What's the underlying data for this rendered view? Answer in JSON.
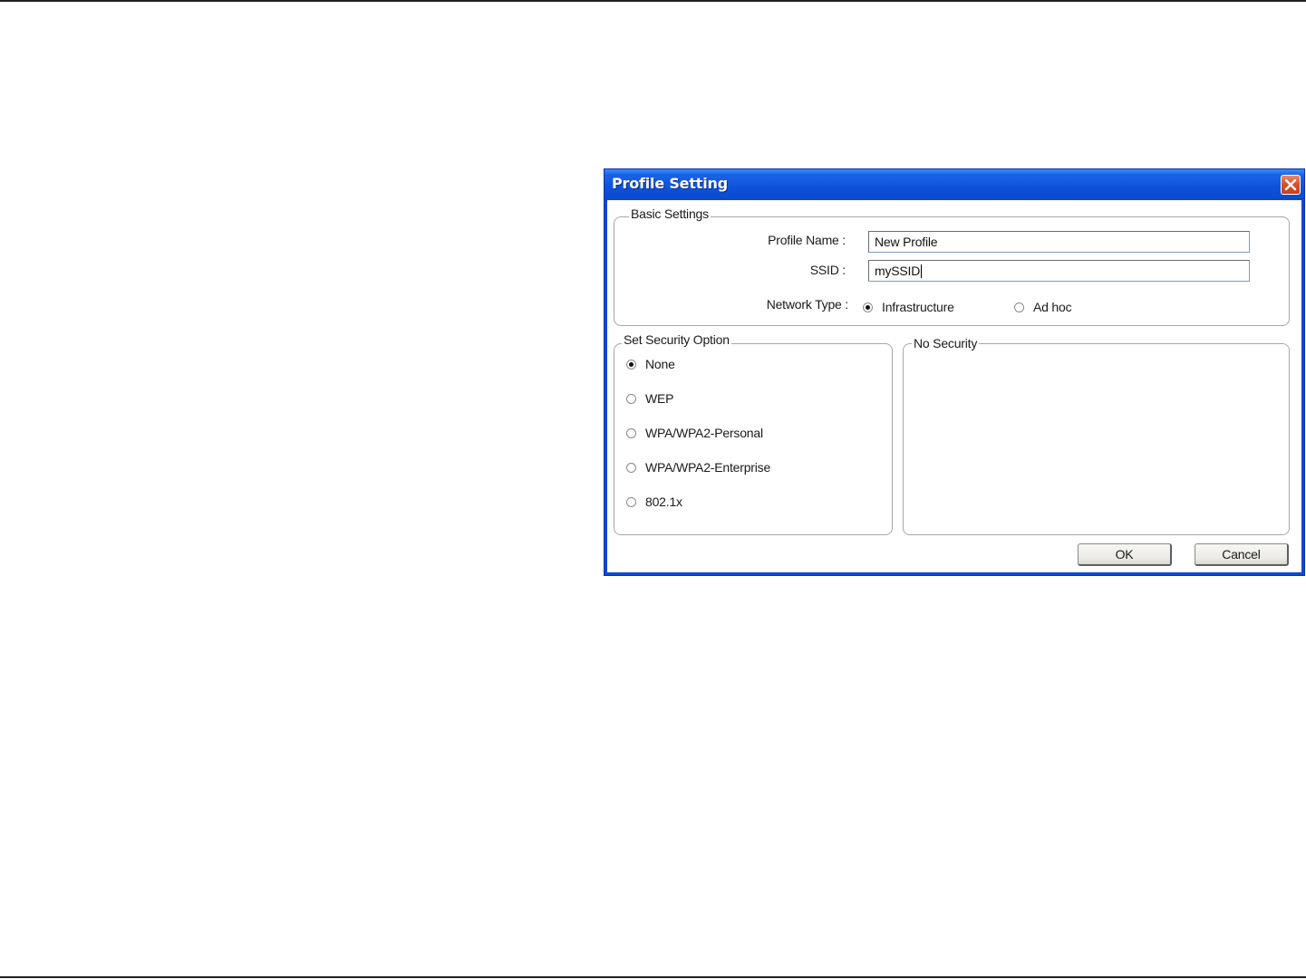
{
  "window": {
    "title": "Profile Setting"
  },
  "basic_settings": {
    "group_label": "Basic Settings",
    "profile_name_label": "Profile Name :",
    "profile_name_value": "New Profile",
    "ssid_label": "SSID :",
    "ssid_value": "mySSID",
    "network_type_label": "Network Type :",
    "network_type_options": [
      {
        "label": "Infrastructure",
        "checked": true
      },
      {
        "label": "Ad hoc",
        "checked": false
      }
    ]
  },
  "security": {
    "group_label": "Set Security Option",
    "options": [
      {
        "label": "None",
        "checked": true
      },
      {
        "label": "WEP",
        "checked": false
      },
      {
        "label": "WPA/WPA2-Personal",
        "checked": false
      },
      {
        "label": "WPA/WPA2-Enterprise",
        "checked": false
      },
      {
        "label": "802.1x",
        "checked": false
      }
    ],
    "detail_group_label": "No Security"
  },
  "buttons": {
    "ok": "OK",
    "cancel": "Cancel"
  },
  "colors": {
    "titlebar": "#0c52d9",
    "close_button": "#d9512c",
    "window_background": "#ffffff"
  },
  "icons": {
    "close": "close-icon"
  }
}
